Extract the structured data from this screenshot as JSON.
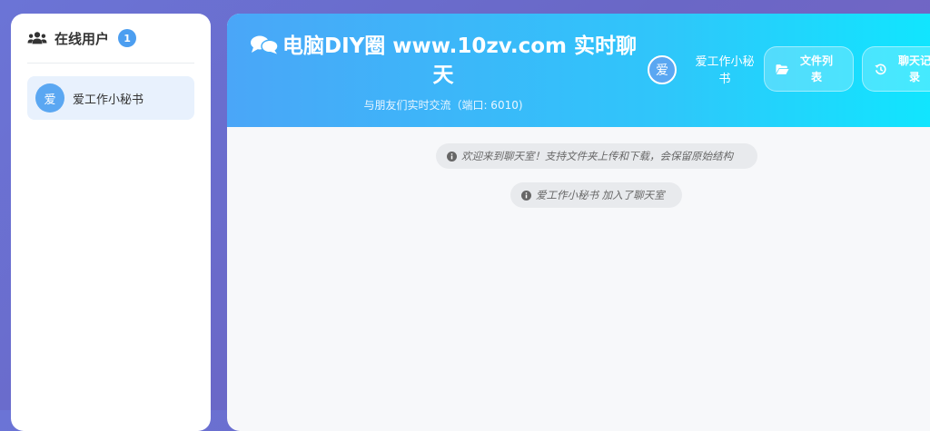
{
  "sidebar": {
    "title": "在线用户",
    "count": "1",
    "users": [
      {
        "avatar": "爱",
        "name": "爱工作小秘书"
      }
    ]
  },
  "header": {
    "title": "电脑DIY圈 www.10zv.com 实时聊天",
    "subtitle": "与朋友们实时交流（端口: 6010)",
    "current_user": {
      "avatar": "爱",
      "name": "爱工作小秘书"
    },
    "buttons": {
      "files": "文件列表",
      "history": "聊天记录"
    }
  },
  "messages": [
    {
      "type": "system",
      "text": "欢迎来到聊天室！支持文件夹上传和下载，会保留原始结构"
    },
    {
      "type": "system",
      "text": "爱工作小秘书 加入了聊天室"
    }
  ],
  "icons": {
    "sidebar": "users-icon",
    "title": "comments-icon",
    "files": "folder-open-icon",
    "history": "history-icon",
    "system": "info-icon"
  },
  "colors": {
    "accent": "#4c9ef0",
    "header_start": "#4aa6f8",
    "header_end": "#0ee8ff"
  }
}
